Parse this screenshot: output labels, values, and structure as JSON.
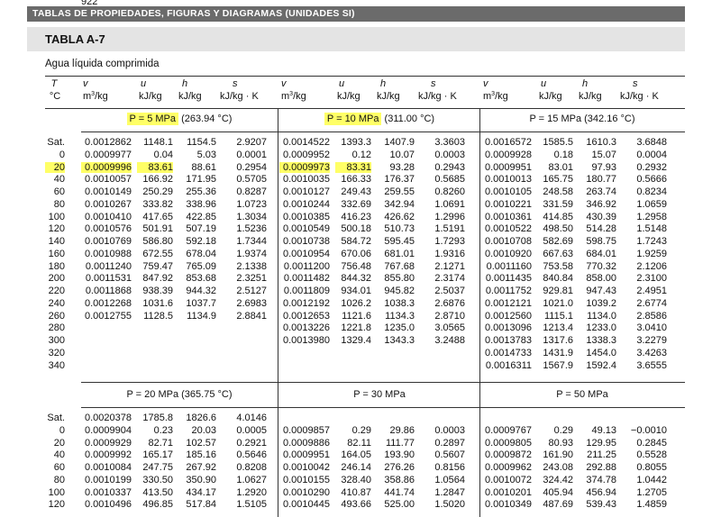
{
  "header": {
    "page_number": "922",
    "running_head": "TABLAS DE PROPIEDADES, FIGURAS Y DIAGRAMAS (UNIDADES SI)"
  },
  "table": {
    "title": "TABLA A-7",
    "subtitle": "Agua líquida comprimida",
    "col_symbols": {
      "T": "T",
      "v": "v",
      "u": "u",
      "h": "h",
      "s": "s"
    },
    "col_units": {
      "T": "°C",
      "v": "m3/kg",
      "u": "kJ/kg",
      "h": "kJ/kg",
      "s": "kJ/kg · K"
    },
    "top_blocks": [
      {
        "label": "P = 5 MPa",
        "sat": "(263.94 °C)",
        "rows": [
          [
            "0.0012862",
            "1148.1",
            "1154.5",
            "2.9207"
          ],
          [
            "0.0009977",
            "0.04",
            "5.03",
            "0.0001"
          ],
          [
            "0.0009996",
            "83.61",
            "88.61",
            "0.2954"
          ],
          [
            "0.0010057",
            "166.92",
            "171.95",
            "0.5705"
          ],
          [
            "0.0010149",
            "250.29",
            "255.36",
            "0.8287"
          ],
          [
            "0.0010267",
            "333.82",
            "338.96",
            "1.0723"
          ],
          [
            "0.0010410",
            "417.65",
            "422.85",
            "1.3034"
          ],
          [
            "0.0010576",
            "501.91",
            "507.19",
            "1.5236"
          ],
          [
            "0.0010769",
            "586.80",
            "592.18",
            "1.7344"
          ],
          [
            "0.0010988",
            "672.55",
            "678.04",
            "1.9374"
          ],
          [
            "0.0011240",
            "759.47",
            "765.09",
            "2.1338"
          ],
          [
            "0.0011531",
            "847.92",
            "853.68",
            "2.3251"
          ],
          [
            "0.0011868",
            "938.39",
            "944.32",
            "2.5127"
          ],
          [
            "0.0012268",
            "1031.6",
            "1037.7",
            "2.6983"
          ],
          [
            "0.0012755",
            "1128.5",
            "1134.9",
            "2.8841"
          ],
          [
            "",
            "",
            "",
            ""
          ],
          [
            "",
            "",
            "",
            ""
          ],
          [
            "",
            "",
            "",
            ""
          ],
          [
            "",
            "",
            "",
            ""
          ]
        ]
      },
      {
        "label": "P = 10 MPa",
        "sat": "(311.00 °C)",
        "rows": [
          [
            "0.0014522",
            "1393.3",
            "1407.9",
            "3.3603"
          ],
          [
            "0.0009952",
            "0.12",
            "10.07",
            "0.0003"
          ],
          [
            "0.0009973",
            "83.31",
            "93.28",
            "0.2943"
          ],
          [
            "0.0010035",
            "166.33",
            "176.37",
            "0.5685"
          ],
          [
            "0.0010127",
            "249.43",
            "259.55",
            "0.8260"
          ],
          [
            "0.0010244",
            "332.69",
            "342.94",
            "1.0691"
          ],
          [
            "0.0010385",
            "416.23",
            "426.62",
            "1.2996"
          ],
          [
            "0.0010549",
            "500.18",
            "510.73",
            "1.5191"
          ],
          [
            "0.0010738",
            "584.72",
            "595.45",
            "1.7293"
          ],
          [
            "0.0010954",
            "670.06",
            "681.01",
            "1.9316"
          ],
          [
            "0.0011200",
            "756.48",
            "767.68",
            "2.1271"
          ],
          [
            "0.0011482",
            "844.32",
            "855.80",
            "2.3174"
          ],
          [
            "0.0011809",
            "934.01",
            "945.82",
            "2.5037"
          ],
          [
            "0.0012192",
            "1026.2",
            "1038.3",
            "2.6876"
          ],
          [
            "0.0012653",
            "1121.6",
            "1134.3",
            "2.8710"
          ],
          [
            "0.0013226",
            "1221.8",
            "1235.0",
            "3.0565"
          ],
          [
            "0.0013980",
            "1329.4",
            "1343.3",
            "3.2488"
          ],
          [
            "",
            "",
            "",
            ""
          ],
          [
            "",
            "",
            "",
            ""
          ]
        ]
      },
      {
        "label": "P = 15 MPa",
        "sat": "(342.16 °C)",
        "rows": [
          [
            "0.0016572",
            "1585.5",
            "1610.3",
            "3.6848"
          ],
          [
            "0.0009928",
            "0.18",
            "15.07",
            "0.0004"
          ],
          [
            "0.0009951",
            "83.01",
            "97.93",
            "0.2932"
          ],
          [
            "0.0010013",
            "165.75",
            "180.77",
            "0.5666"
          ],
          [
            "0.0010105",
            "248.58",
            "263.74",
            "0.8234"
          ],
          [
            "0.0010221",
            "331.59",
            "346.92",
            "1.0659"
          ],
          [
            "0.0010361",
            "414.85",
            "430.39",
            "1.2958"
          ],
          [
            "0.0010522",
            "498.50",
            "514.28",
            "1.5148"
          ],
          [
            "0.0010708",
            "582.69",
            "598.75",
            "1.7243"
          ],
          [
            "0.0010920",
            "667.63",
            "684.01",
            "1.9259"
          ],
          [
            "0.0011160",
            "753.58",
            "770.32",
            "2.1206"
          ],
          [
            "0.0011435",
            "840.84",
            "858.00",
            "2.3100"
          ],
          [
            "0.0011752",
            "929.81",
            "947.43",
            "2.4951"
          ],
          [
            "0.0012121",
            "1021.0",
            "1039.2",
            "2.6774"
          ],
          [
            "0.0012560",
            "1115.1",
            "1134.0",
            "2.8586"
          ],
          [
            "0.0013096",
            "1213.4",
            "1233.0",
            "3.0410"
          ],
          [
            "0.0013783",
            "1317.6",
            "1338.3",
            "3.2279"
          ],
          [
            "0.0014733",
            "1431.9",
            "1454.0",
            "3.4263"
          ],
          [
            "0.0016311",
            "1567.9",
            "1592.4",
            "3.6555"
          ]
        ]
      }
    ],
    "top_temps": [
      "Sat.",
      "0",
      "20",
      "40",
      "60",
      "80",
      "100",
      "120",
      "140",
      "160",
      "180",
      "200",
      "220",
      "240",
      "260",
      "280",
      "300",
      "320",
      "340"
    ],
    "bottom_blocks": [
      {
        "label": "P = 20 MPa",
        "sat": "(365.75 °C)",
        "rows": [
          [
            "0.0020378",
            "1785.8",
            "1826.6",
            "4.0146"
          ],
          [
            "0.0009904",
            "0.23",
            "20.03",
            "0.0005"
          ],
          [
            "0.0009929",
            "82.71",
            "102.57",
            "0.2921"
          ],
          [
            "0.0009992",
            "165.17",
            "185.16",
            "0.5646"
          ],
          [
            "0.0010084",
            "247.75",
            "267.92",
            "0.8208"
          ],
          [
            "0.0010199",
            "330.50",
            "350.90",
            "1.0627"
          ],
          [
            "0.0010337",
            "413.50",
            "434.17",
            "1.2920"
          ],
          [
            "0.0010496",
            "496.85",
            "517.84",
            "1.5105"
          ]
        ]
      },
      {
        "label": "P = 30 MPa",
        "sat": "",
        "rows": [
          [
            "",
            "",
            "",
            ""
          ],
          [
            "0.0009857",
            "0.29",
            "29.86",
            "0.0003"
          ],
          [
            "0.0009886",
            "82.11",
            "111.77",
            "0.2897"
          ],
          [
            "0.0009951",
            "164.05",
            "193.90",
            "0.5607"
          ],
          [
            "0.0010042",
            "246.14",
            "276.26",
            "0.8156"
          ],
          [
            "0.0010155",
            "328.40",
            "358.86",
            "1.0564"
          ],
          [
            "0.0010290",
            "410.87",
            "441.74",
            "1.2847"
          ],
          [
            "0.0010445",
            "493.66",
            "525.00",
            "1.5020"
          ]
        ]
      },
      {
        "label": "P = 50 MPa",
        "sat": "",
        "rows": [
          [
            "",
            "",
            "",
            ""
          ],
          [
            "0.0009767",
            "0.29",
            "49.13",
            "−0.0010"
          ],
          [
            "0.0009805",
            "80.93",
            "129.95",
            "0.2845"
          ],
          [
            "0.0009872",
            "161.90",
            "211.25",
            "0.5528"
          ],
          [
            "0.0009962",
            "243.08",
            "292.88",
            "0.8055"
          ],
          [
            "0.0010072",
            "324.42",
            "374.78",
            "1.0442"
          ],
          [
            "0.0010201",
            "405.94",
            "456.94",
            "1.2705"
          ],
          [
            "0.0010349",
            "487.69",
            "539.43",
            "1.4859"
          ]
        ]
      }
    ],
    "bottom_temps": [
      "Sat.",
      "0",
      "20",
      "40",
      "60",
      "80",
      "100",
      "120"
    ],
    "highlight_color": "#ffff66"
  }
}
